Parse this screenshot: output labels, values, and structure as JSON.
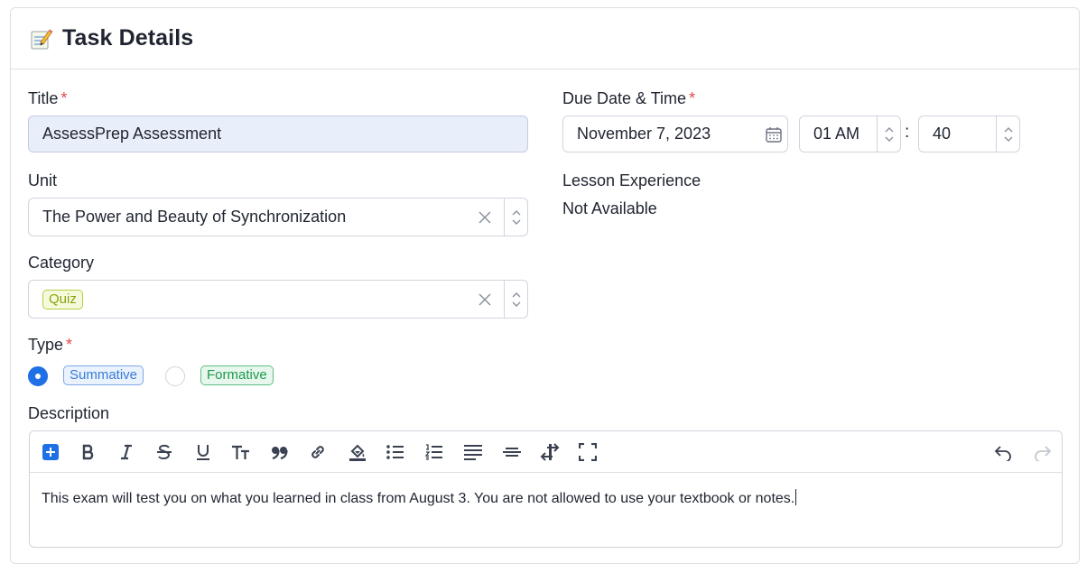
{
  "card": {
    "title": "Task Details"
  },
  "title_field": {
    "label": "Title",
    "required_mark": "*",
    "value": "AssessPrep Assessment"
  },
  "due": {
    "label": "Due Date & Time",
    "required_mark": "*",
    "date": "November 7, 2023",
    "hour": "01 AM",
    "separator": ":",
    "minute": "40"
  },
  "unit": {
    "label": "Unit",
    "value": "The Power and Beauty of Synchronization"
  },
  "lesson": {
    "label": "Lesson Experience",
    "value": "Not Available"
  },
  "category": {
    "label": "Category",
    "tag": "Quiz"
  },
  "type": {
    "label": "Type",
    "required_mark": "*",
    "options": [
      {
        "label": "Summative",
        "selected": true
      },
      {
        "label": "Formative",
        "selected": false
      }
    ]
  },
  "description": {
    "label": "Description",
    "text": "This exam will test you on what you learned in class from August 3. You are not allowed to use your textbook or notes.",
    "toolbar": [
      "insert-icon",
      "bold-icon",
      "italic-icon",
      "strikethrough-icon",
      "underline-icon",
      "text-size-icon",
      "quote-icon",
      "link-icon",
      "highlight-icon",
      "bullet-list-icon",
      "numbered-list-icon",
      "align-icon",
      "horizontal-rule-icon",
      "direction-icon",
      "fullscreen-icon",
      "undo-icon",
      "redo-icon"
    ]
  },
  "colors": {
    "accent": "#1f6fe5",
    "required": "#e5484d",
    "filled_bg": "#e9eefb"
  }
}
